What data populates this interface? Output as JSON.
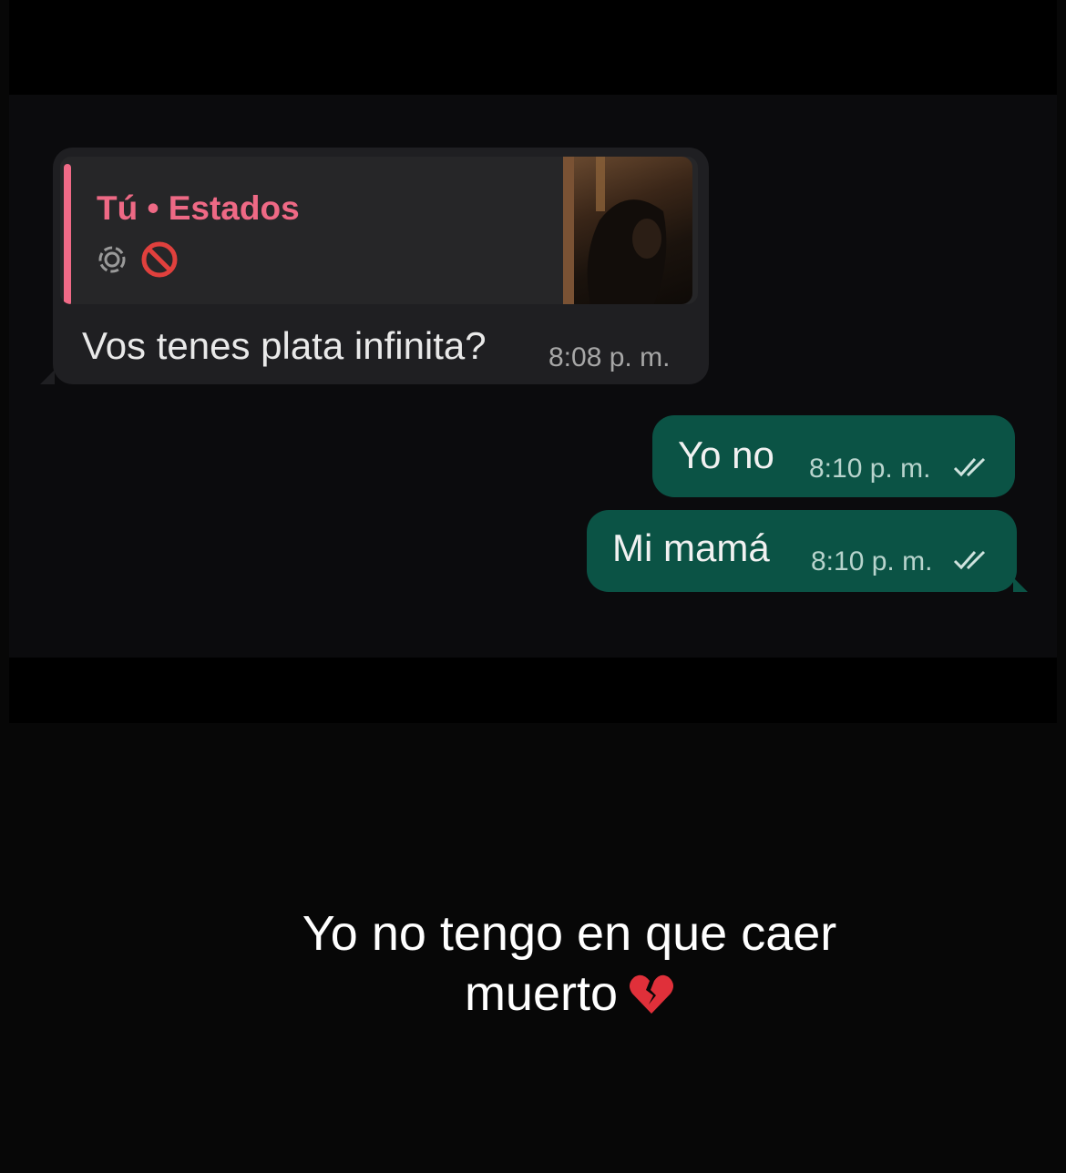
{
  "chat": {
    "incoming": {
      "reply_title": "Tú • Estados",
      "text": "Vos tenes plata infinita?",
      "time": "8:08 p. m."
    },
    "outgoing": [
      {
        "text": "Yo no",
        "time": "8:10 p. m."
      },
      {
        "text": "Mi mamá",
        "time": "8:10 p. m."
      }
    ]
  },
  "caption": {
    "line1": "Yo no tengo en que caer",
    "line2": "muerto",
    "emoji_icon": "broken-heart-icon"
  },
  "colors": {
    "background": "#070707",
    "incoming_bubble": "#1f1f22",
    "outgoing_bubble": "#0b5345",
    "quote_accent": "#ee6985"
  }
}
